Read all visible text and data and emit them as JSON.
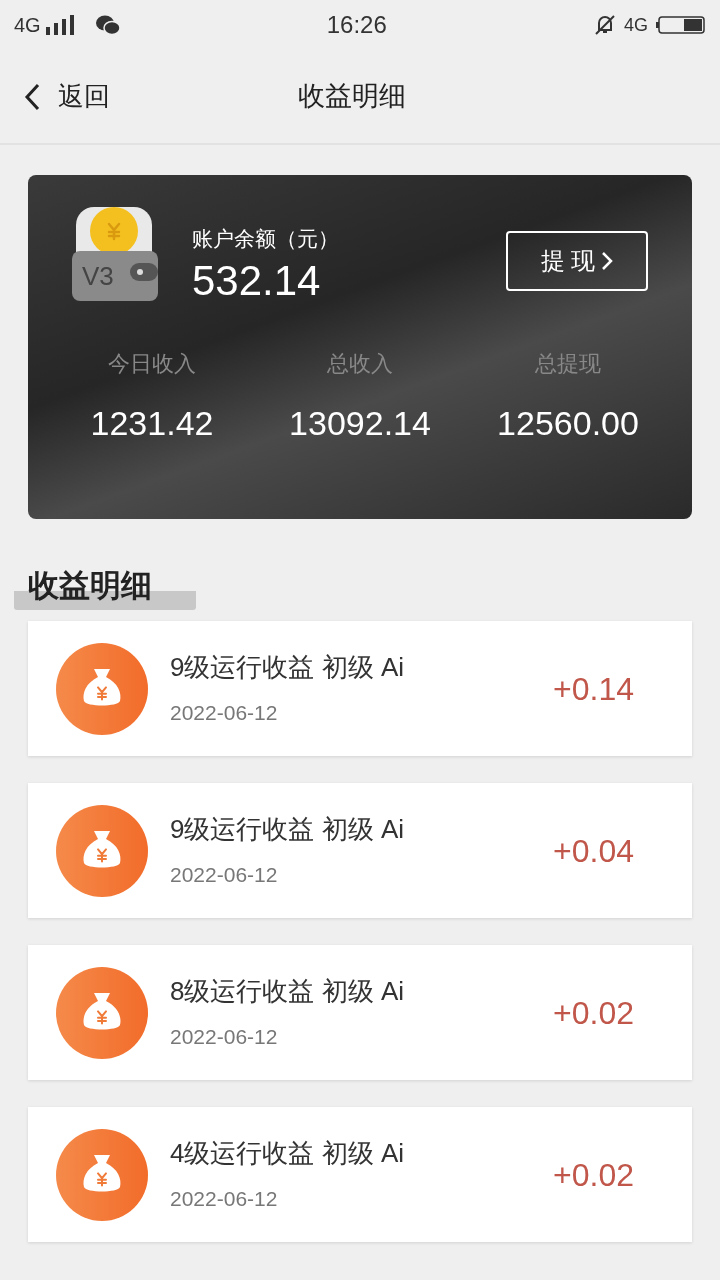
{
  "status_bar": {
    "network": "4G",
    "time": "16:26",
    "network_right": "4G"
  },
  "header": {
    "back": "返回",
    "title": "收益明细"
  },
  "account": {
    "badge": "V3",
    "label": "账户余额（元）",
    "balance": "532.14",
    "withdraw": "提 现",
    "stats": [
      {
        "label": "今日收入",
        "value": "1231.42"
      },
      {
        "label": "总收入",
        "value": "13092.14"
      },
      {
        "label": "总提现",
        "value": "12560.00"
      }
    ]
  },
  "section_title": "收益明细",
  "records": [
    {
      "title": "9级运行收益 初级 Ai",
      "date": "2022-06-12",
      "amount": "+0.14"
    },
    {
      "title": "9级运行收益 初级 Ai",
      "date": "2022-06-12",
      "amount": "+0.04"
    },
    {
      "title": "8级运行收益 初级 Ai",
      "date": "2022-06-12",
      "amount": "+0.02"
    },
    {
      "title": "4级运行收益 初级 Ai",
      "date": "2022-06-12",
      "amount": "+0.02"
    }
  ]
}
